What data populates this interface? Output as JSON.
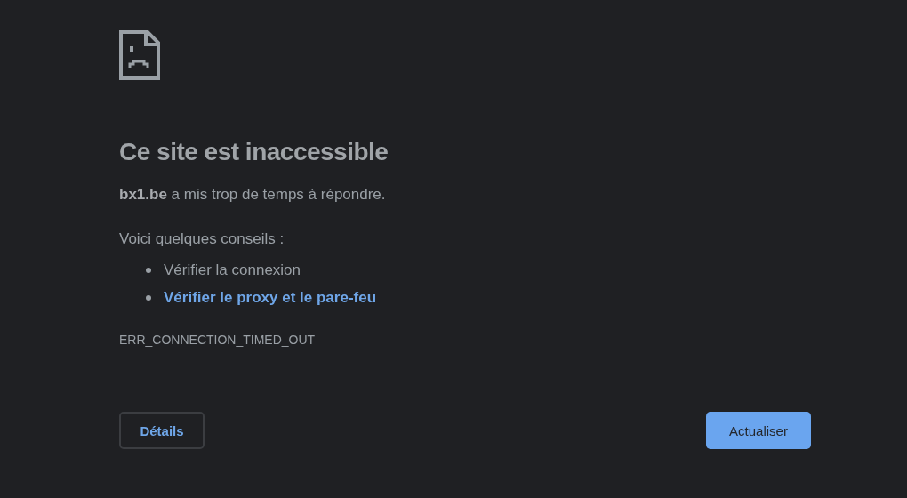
{
  "heading": "Ce site est inaccessible",
  "message": "**bx1.be** a mis trop de temps à répondre.",
  "tips_intro": "Voici quelques conseils :",
  "tips": [
    {
      "kind": "text",
      "label": "Vérifier la connexion"
    },
    {
      "kind": "link",
      "label": "Vérifier le proxy et le pare-feu"
    }
  ],
  "error_code": "ERR_CONNECTION_TIMED_OUT",
  "buttons": {
    "details": "Détails",
    "reload": "Actualiser"
  }
}
